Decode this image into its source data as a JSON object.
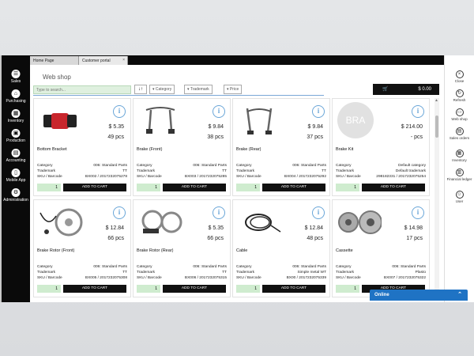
{
  "tabs": [
    {
      "label": "Home Page"
    },
    {
      "label": "Customer portal",
      "close": "×"
    }
  ],
  "left_nav": [
    {
      "label": "Sales",
      "icon": "sales-icon",
      "glyph": "☰"
    },
    {
      "label": "Purchasing",
      "icon": "purchasing-icon",
      "glyph": "⌂"
    },
    {
      "label": "Inventory",
      "icon": "inventory-icon",
      "glyph": "▦"
    },
    {
      "label": "Production",
      "icon": "production-icon",
      "glyph": "▣"
    },
    {
      "label": "Accounting",
      "icon": "accounting-icon",
      "glyph": "▤"
    },
    {
      "label": "Mobile App",
      "icon": "mobile-icon",
      "glyph": "▯"
    },
    {
      "label": "Administration",
      "icon": "gear-icon",
      "glyph": "⚙"
    }
  ],
  "right_nav": [
    {
      "label": "Close",
      "icon": "close-icon",
      "glyph": "×"
    },
    {
      "label": "Refresh",
      "icon": "refresh-icon",
      "glyph": "↻"
    },
    {
      "label": "Web shop",
      "icon": "webshop-icon",
      "glyph": "▭"
    },
    {
      "label": "Sales orders",
      "icon": "sales-orders-icon",
      "glyph": "▤"
    },
    {
      "label": "Inventory",
      "icon": "inventory-icon",
      "glyph": "▦"
    },
    {
      "label": "Financial ledger",
      "icon": "ledger-icon",
      "glyph": "▥"
    },
    {
      "label": "User",
      "icon": "user-icon",
      "glyph": "☺"
    }
  ],
  "toolbar": {
    "title": "Web shop",
    "search_placeholder": "Type to search...",
    "sort_glyph": "↓↑",
    "filters": [
      "Category",
      "Trademark",
      "Price"
    ],
    "cart_total": "$ 0.00",
    "cart_glyph": "🛒"
  },
  "field_labels": {
    "category": "Category",
    "trademark": "Trademark",
    "sku": "SKU / Barcode"
  },
  "add_to_cart": "ADD TO CART",
  "info_glyph": "i",
  "products": [
    {
      "name": "Bottom Bracket",
      "price": "$ 5.35",
      "stock": "49 pcs",
      "category": "006: Standard Parts",
      "trademark": "TT",
      "sku": "BX002 / 2017232075278",
      "qty": "1",
      "image": "bottom-bracket"
    },
    {
      "name": "Brake (Front)",
      "price": "$ 9.84",
      "stock": "38 pcs",
      "category": "006: Standard Parts",
      "trademark": "TT",
      "sku": "BX003 / 2017232075285",
      "qty": "1",
      "image": "brake-front"
    },
    {
      "name": "Brake (Rear)",
      "price": "$ 9.84",
      "stock": "37 pcs",
      "category": "006: Standard Parts",
      "trademark": "TT",
      "sku": "BX004 / 2017232075292",
      "qty": "1",
      "image": "brake-rear"
    },
    {
      "name": "Brake Kit",
      "price": "$ 214.00",
      "stock": "- pcs",
      "category": "Default category",
      "trademark": "Default trademark",
      "sku": "298182331 / 2017232075254",
      "qty": "1",
      "image": "placeholder",
      "placeholder_text": "BRA"
    },
    {
      "name": "Brake Rotor (Front)",
      "price": "$ 12.84",
      "stock": "66 pcs",
      "category": "006: Standard Parts",
      "trademark": "TT",
      "sku": "BX005 / 2017232075308",
      "qty": "1",
      "image": "brake-rotor-front"
    },
    {
      "name": "Brake Rotor (Rear)",
      "price": "$ 5.35",
      "stock": "66 pcs",
      "category": "006: Standard Parts",
      "trademark": "TT",
      "sku": "BX006 / 2017232075315",
      "qty": "1",
      "image": "brake-rotor-rear"
    },
    {
      "name": "Cable",
      "price": "$ 12.84",
      "stock": "48 pcs",
      "category": "006: Standard Parts",
      "trademark": "Simple metal WT",
      "sku": "BX00 / 2017232075339",
      "qty": "1",
      "image": "cable"
    },
    {
      "name": "Cassette",
      "price": "$ 14.98",
      "stock": "17 pcs",
      "category": "006: Standard Parts",
      "trademark": "Plasto",
      "sku": "BX007 / 2017232075322",
      "qty": "1",
      "image": "cassette"
    }
  ],
  "chat": {
    "label": "Online",
    "chevron": "⌃"
  },
  "colors": {
    "accent": "#1f73c4",
    "search_bg": "#dff0df",
    "info_blue": "#6aa6d8",
    "sidebar_bg": "#0a0a0a"
  }
}
